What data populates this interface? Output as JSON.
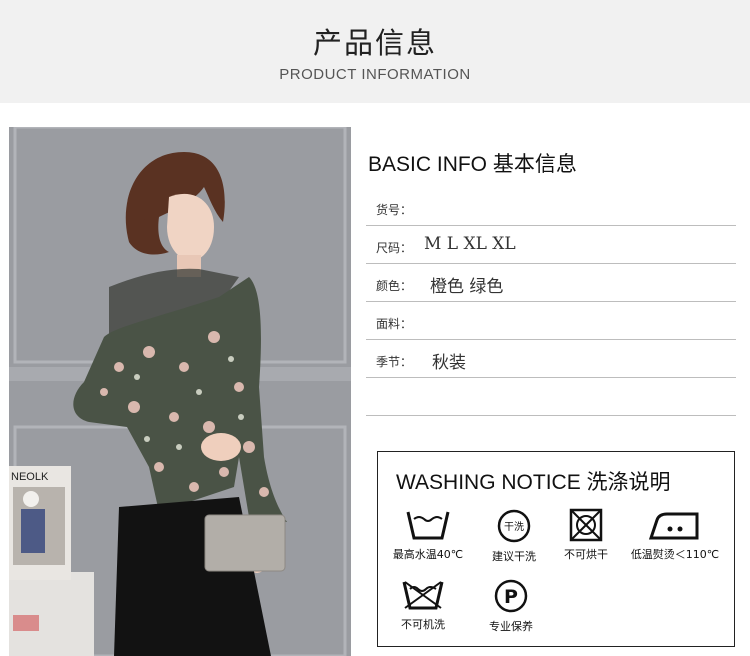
{
  "header": {
    "title_cn": "产品信息",
    "title_en": "PRODUCT INFORMATION"
  },
  "photo": {
    "magazine_text": "NEOLK"
  },
  "basic_info": {
    "title": "BASIC INFO 基本信息",
    "rows": [
      {
        "label": "货号：",
        "value": ""
      },
      {
        "label": "尺码：",
        "value": "M L XL XL"
      },
      {
        "label": "颜色：",
        "value": "橙色 绿色"
      },
      {
        "label": "面料：",
        "value": ""
      },
      {
        "label": "季节：",
        "value": "秋装"
      }
    ]
  },
  "washing_notice": {
    "title": "WASHING NOTICE 洗涤说明",
    "items": [
      {
        "icon": "wash-tub-icon",
        "caption": "最高水温40℃"
      },
      {
        "icon": "dry-clean-icon",
        "symbol": "干洗",
        "caption": "建议干洗"
      },
      {
        "icon": "tumble-dry-prohibited-icon",
        "caption": "不可烘干"
      },
      {
        "icon": "low-temperature-iron-icon",
        "caption": "低温熨烫＜110℃"
      },
      {
        "icon": "no-machine-wash-icon",
        "caption": "不可机洗"
      },
      {
        "icon": "professional-care-icon",
        "symbol": "P",
        "caption": "专业保养"
      }
    ]
  }
}
